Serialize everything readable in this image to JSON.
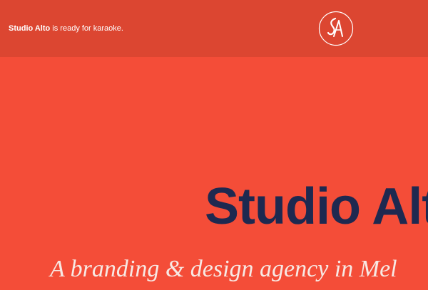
{
  "header": {
    "tagline_brand": "Studio Alto",
    "tagline_rest": " is ready for karaoke.",
    "logo_icon": "studio-alto-monogram"
  },
  "hero": {
    "title": "Studio Alt",
    "subtitle": "A branding & design agency in Mel"
  },
  "colors": {
    "page_background": "#f44d38",
    "header_background": "#dc4631",
    "title": "#1e2950",
    "subtitle": "#f7e9e4",
    "tagline": "#ffffff"
  }
}
